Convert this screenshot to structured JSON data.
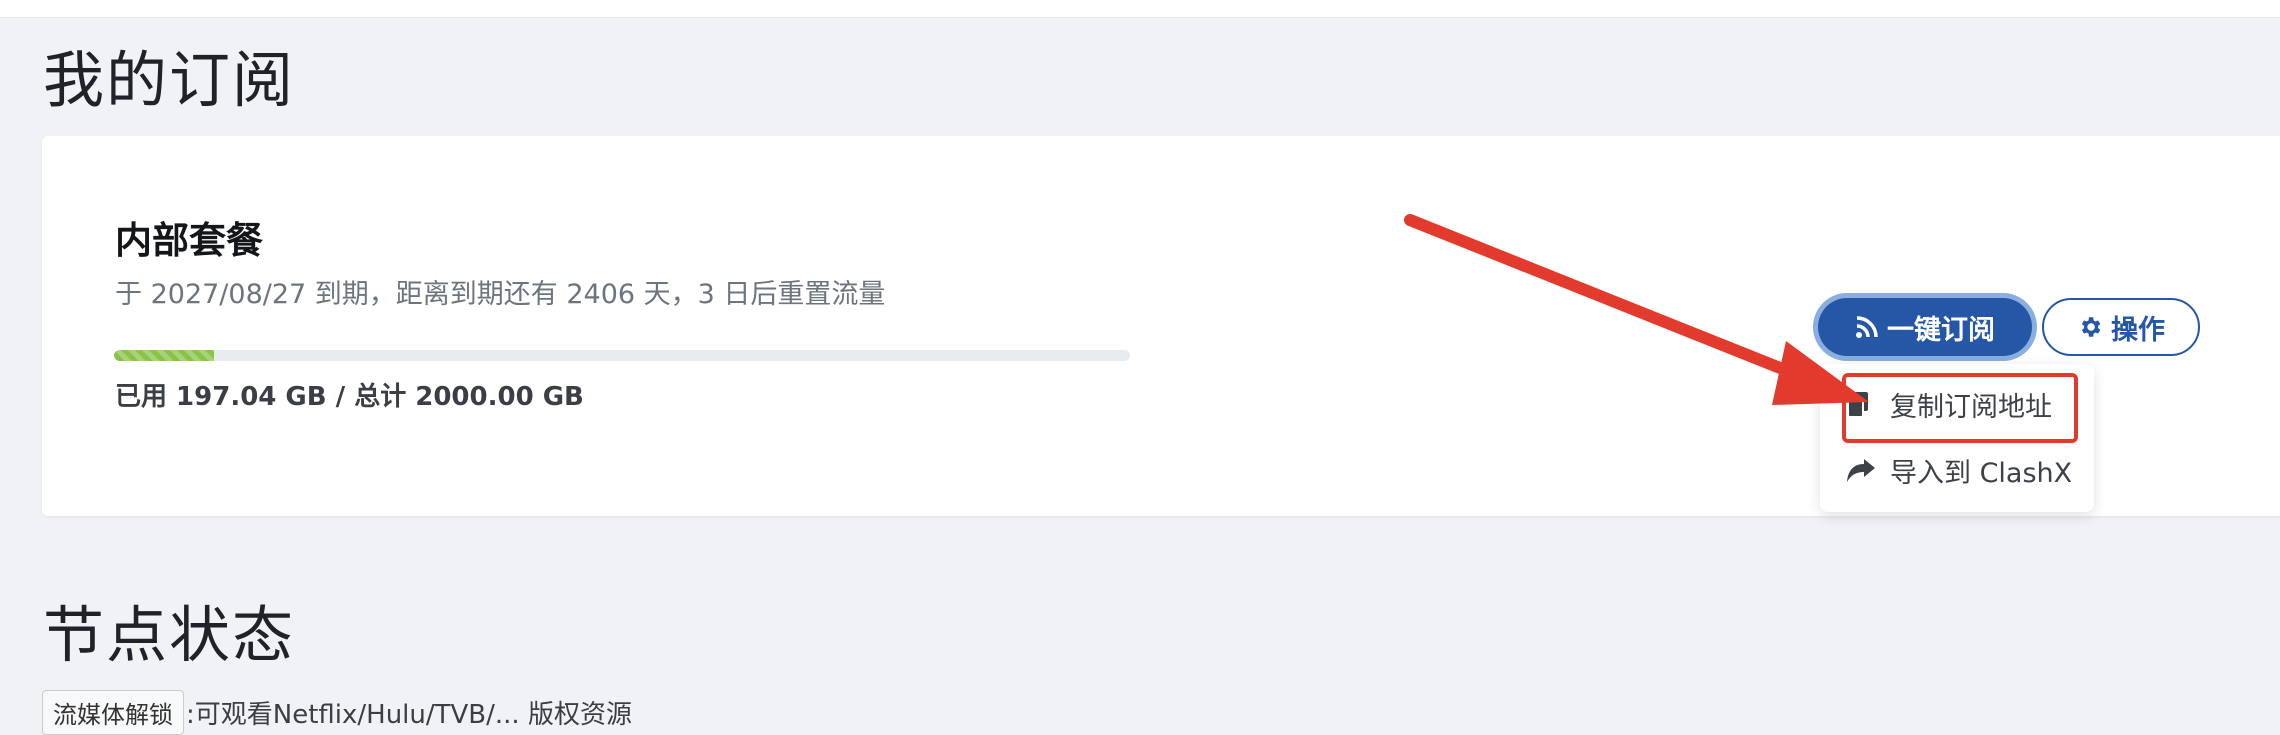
{
  "sections": {
    "subscriptions_title": "我的订阅",
    "nodes_title": "节点状态"
  },
  "plan": {
    "name": "内部套餐",
    "expiry_text": "于 2027/08/27 到期，距离到期还有 2406 天，3 日后重置流量",
    "usage_text": "已用 197.04 GB / 总计 2000.00 GB",
    "usage_fraction": 0.0985
  },
  "buttons": {
    "subscribe": "一键订阅",
    "operations": "操作"
  },
  "dropdown": {
    "items": [
      {
        "label": "复制订阅地址",
        "icon": "copy-icon"
      },
      {
        "label": "导入到 ClashX",
        "icon": "share-arrow-icon"
      }
    ]
  },
  "stream": {
    "badge": "流媒体解锁",
    "description": ":可观看Netflix/Hulu/TVB/... 版权资源"
  },
  "colors": {
    "primary": "#2557a6",
    "progress": "#8bc34a",
    "annotation_red": "#e23b2e"
  }
}
